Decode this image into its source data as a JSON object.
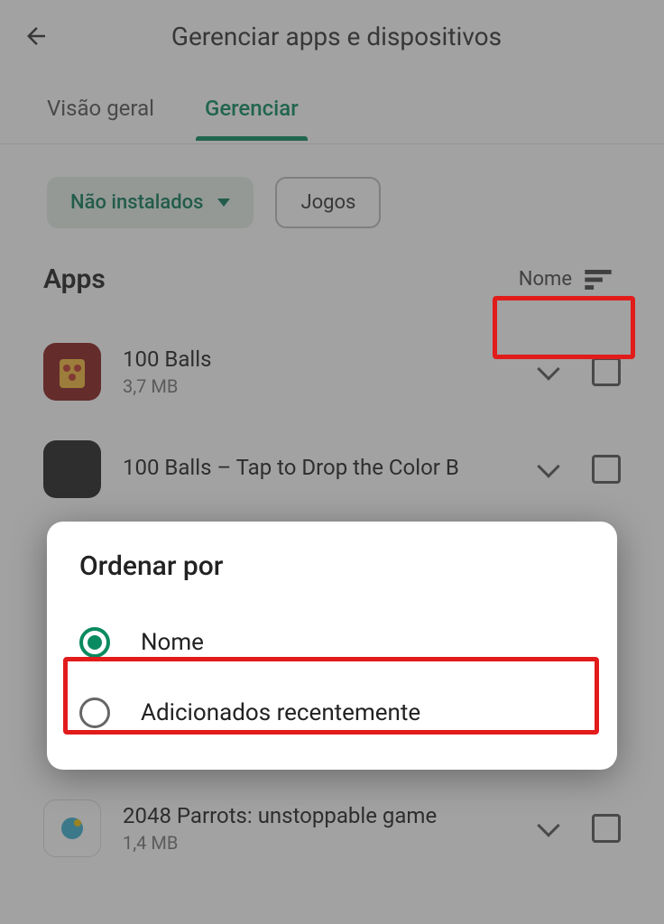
{
  "header": {
    "title": "Gerenciar apps e dispositivos"
  },
  "tabs": {
    "overview": "Visão geral",
    "manage": "Gerenciar"
  },
  "filters": {
    "not_installed": "Não instalados",
    "games": "Jogos"
  },
  "section": {
    "title": "Apps",
    "sort_label": "Nome"
  },
  "apps": [
    {
      "name": "100 Balls",
      "size": "3,7 MB"
    },
    {
      "name": "100 Balls – Tap to Drop the Color B",
      "size": ""
    },
    {
      "name": "2048 Parrots: unstoppable game",
      "size": "1,4 MB"
    }
  ],
  "dialog": {
    "title": "Ordenar por",
    "option_name": "Nome",
    "option_recent": "Adicionados recentemente"
  }
}
